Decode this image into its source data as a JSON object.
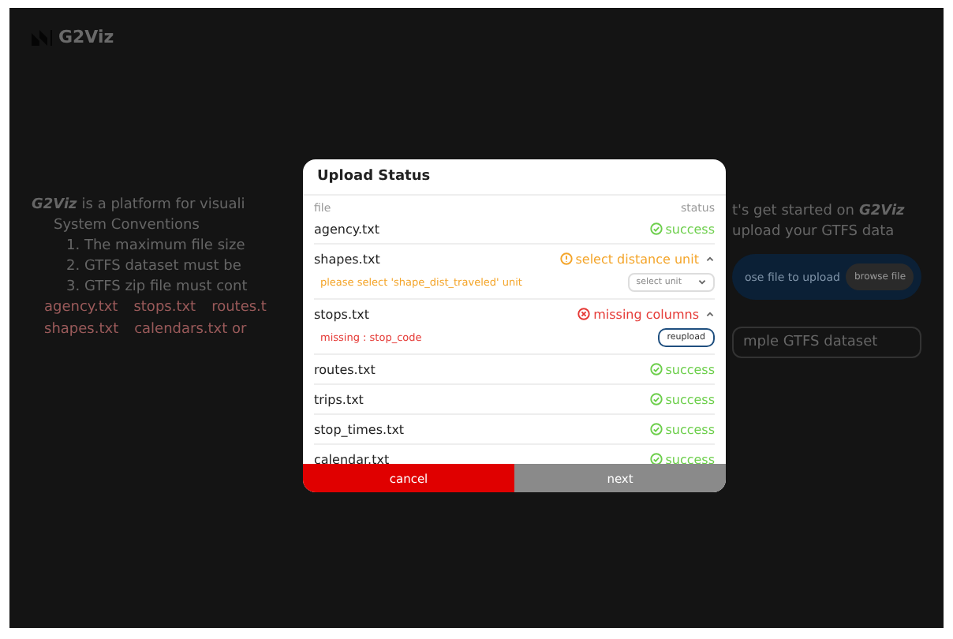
{
  "header": {
    "logo_text": "G2Viz"
  },
  "background": {
    "intro_brand": "G2Viz",
    "intro_text": "is a platform for visuali",
    "conventions_title": "System Conventions",
    "conventions": [
      "1. The maximum file size",
      "2. GTFS dataset must be",
      "3. GTFS zip file must cont"
    ],
    "tags": [
      "agency.txt",
      "stops.txt",
      "routes.t",
      "shapes.txt",
      "calendars.txt or"
    ],
    "start_text": "t's get started on",
    "start_brand": "G2Viz",
    "upload_text": "upload your GTFS data",
    "drop_text": "ose file to upload",
    "browse_button": "browse file",
    "sample_text": "mple GTFS dataset"
  },
  "modal": {
    "title": "Upload Status",
    "column_file": "file",
    "column_status": "status",
    "rows": [
      {
        "file": "agency.txt",
        "kind": "success",
        "status": "success"
      },
      {
        "file": "shapes.txt",
        "kind": "warning",
        "status": "select distance unit",
        "expanded": true,
        "message": "please select 'shape_dist_traveled' unit",
        "select_placeholder": "select unit"
      },
      {
        "file": "stops.txt",
        "kind": "error",
        "status": "missing columns",
        "expanded": true,
        "message": "missing : stop_code",
        "action": "reupload"
      },
      {
        "file": "routes.txt",
        "kind": "success",
        "status": "success"
      },
      {
        "file": "trips.txt",
        "kind": "success",
        "status": "success"
      },
      {
        "file": "stop_times.txt",
        "kind": "success",
        "status": "success"
      },
      {
        "file": "calendar.txt",
        "kind": "success",
        "status": "success"
      }
    ],
    "cancel_button": "cancel",
    "next_button": "next",
    "next_disabled": true
  }
}
